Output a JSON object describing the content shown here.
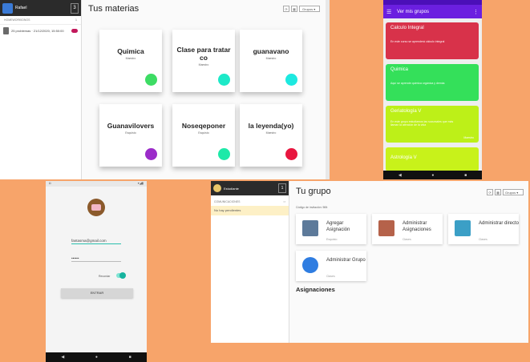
{
  "materias": {
    "user": "Rafael",
    "side_btn": "3",
    "section_label": "HOMEWORKIDNOS",
    "section_count": "1",
    "item_label": "25 problemas · 21/12/2020, 15:50:00",
    "title": "Tus materias",
    "filter": "Grupos ▾",
    "cards": [
      {
        "name": "Quimica",
        "sub": "Maestro",
        "color": "#3ddc64"
      },
      {
        "name": "Clase para tratar co",
        "sub": "Maestro",
        "color": "#1de9c8"
      },
      {
        "name": "guanavano",
        "sub": "Maestro",
        "color": "#1de9e0"
      },
      {
        "name": "Guanavilovers",
        "sub": "Esquisto",
        "color": "#9b2cc9"
      },
      {
        "name": "Noseqeponer",
        "sub": "Esquisto",
        "color": "#1de9a8"
      },
      {
        "name": "la leyenda(yo)",
        "sub": "Maestro",
        "color": "#e8163f"
      }
    ]
  },
  "grupos": {
    "title": "Ver mis grupos",
    "groups": [
      {
        "name": "Calculo Integral",
        "desc": "En este curso se aprenderá cálculo integral",
        "teacher": "",
        "color": "#d8324a"
      },
      {
        "name": "Quimica",
        "desc": "Aquí se aprende química orgánica y demás",
        "teacher": "",
        "color": "#34e05a"
      },
      {
        "name": "Geriatología V",
        "desc": "En este grupo estudiamos las sucursales que más llaman la atención de la vida",
        "teacher": "Maestro",
        "color": "#bdf018"
      },
      {
        "name": "Astrología V",
        "desc": "",
        "teacher": "",
        "color": "#c8f21a"
      }
    ]
  },
  "login": {
    "email": "fantasma@gmail.com",
    "password": "••••••",
    "remember": "Recordar",
    "button": "ENTRAR"
  },
  "grupo": {
    "user": "Estudiante",
    "side_btn": "1",
    "section_label": "COMUNICACIONES",
    "empty_label": "No hay pendientes",
    "title": "Tu grupo",
    "filter": "Grupos ▾",
    "invite": "Código de invitación: 5t5t",
    "actions": [
      {
        "name": "Agregar Asignación",
        "sub": "Esquisto",
        "icon": "clipboard-icon",
        "color": "#5d7a9a"
      },
      {
        "name": "Administrar Asignaciones",
        "sub": "Clases",
        "icon": "notebook-icon",
        "color": "#b5624a"
      },
      {
        "name": "Administrar directo",
        "sub": "Clases",
        "icon": "monitor-icon",
        "color": "#3b9fc6"
      },
      {
        "name": "Administrar Grupo",
        "sub": "Clases",
        "icon": "people-icon",
        "color": "#2f7de1"
      }
    ],
    "section": "Asignaciones"
  }
}
